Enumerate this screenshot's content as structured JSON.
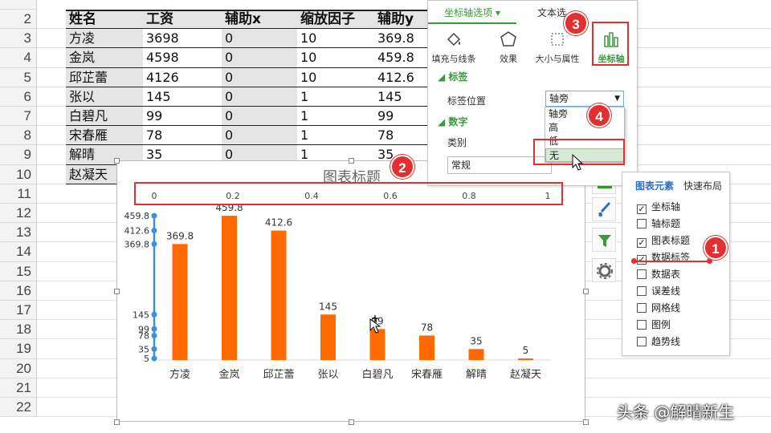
{
  "spreadsheet": {
    "row_numbers": [
      "2",
      "3",
      "4",
      "5",
      "6",
      "7",
      "8",
      "9",
      "10",
      "11",
      "12",
      "13",
      "14",
      "15",
      "16",
      "17",
      "18",
      "19",
      "20",
      "21",
      "22"
    ],
    "headers": [
      "姓名",
      "工资",
      "辅助x",
      "缩放因子",
      "辅助y"
    ],
    "rows": [
      [
        "方凌",
        "3698",
        "0",
        "10",
        "369.8"
      ],
      [
        "金岚",
        "4598",
        "0",
        "10",
        "459.8"
      ],
      [
        "邱芷蕾",
        "4126",
        "0",
        "10",
        "412.6"
      ],
      [
        "张以",
        "145",
        "0",
        "1",
        "145"
      ],
      [
        "白碧凡",
        "99",
        "0",
        "1",
        "99"
      ],
      [
        "宋春雁",
        "78",
        "0",
        "1",
        "78"
      ],
      [
        "解晴",
        "35",
        "0",
        "1",
        "35"
      ],
      [
        "赵凝天",
        "",
        "",
        "",
        ""
      ]
    ]
  },
  "chart": {
    "title": "图表标题",
    "secondary_axis_ticks": [
      "0",
      "0.2",
      "0.4",
      "0.6",
      "0.8",
      "1"
    ],
    "left_axis_labels": [
      "459.8",
      "412.6",
      "369.8",
      "145",
      "99",
      "78",
      "35",
      "5"
    ],
    "bar_color": "#ff6a00",
    "axis_color": "#3b8fdd"
  },
  "chart_data": {
    "type": "bar",
    "categories": [
      "方凌",
      "金岚",
      "邱芷蕾",
      "张以",
      "白碧凡",
      "宋春雁",
      "解晴",
      "赵凝天"
    ],
    "values": [
      369.8,
      459.8,
      412.6,
      145,
      99,
      78,
      35,
      5
    ],
    "data_labels": [
      "369.8",
      "459.8",
      "412.6",
      "145",
      "99",
      "78",
      "35",
      "5"
    ],
    "title": "图表标题",
    "ylim": [
      0,
      460
    ]
  },
  "format_pane": {
    "tab_axis_options": "坐标轴选项",
    "tab_text_options": "文本选",
    "tools": [
      "填充与线条",
      "效果",
      "大小与属性",
      "坐标轴"
    ],
    "section_labels": "标签",
    "label_position_label": "标签位置",
    "label_position_value": "轴旁",
    "label_position_options": [
      "轴旁",
      "高",
      "低",
      "无"
    ],
    "section_number": "数字",
    "category_label": "类别",
    "category_value": "常规"
  },
  "chart_elements": {
    "tab_elements": "图表元素",
    "tab_quick_layout": "快速布局",
    "items": [
      {
        "label": "坐标轴",
        "checked": true
      },
      {
        "label": "轴标题",
        "checked": false
      },
      {
        "label": "图表标题",
        "checked": true
      },
      {
        "label": "数据标签",
        "checked": true
      },
      {
        "label": "数据表",
        "checked": false
      },
      {
        "label": "误差线",
        "checked": false
      },
      {
        "label": "网格线",
        "checked": false
      },
      {
        "label": "图例",
        "checked": false
      },
      {
        "label": "趋势线",
        "checked": false
      }
    ]
  },
  "badges": [
    "1",
    "2",
    "3",
    "4"
  ],
  "watermark": "头条 @解晴新生"
}
